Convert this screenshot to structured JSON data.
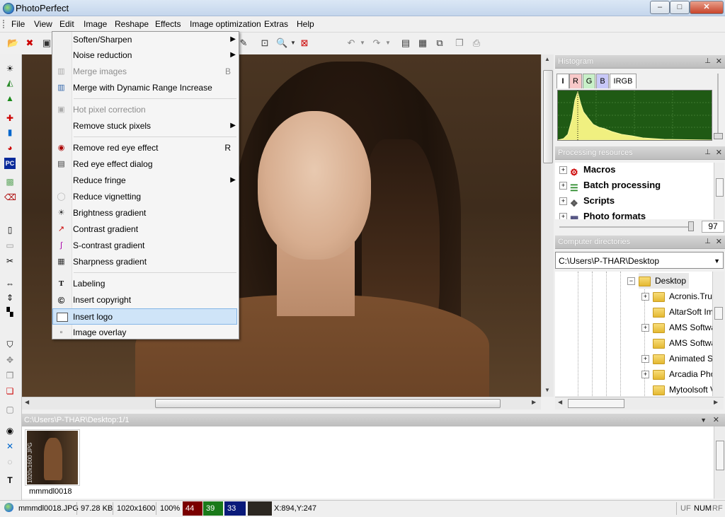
{
  "window": {
    "title": "PhotoPerfect",
    "controls": {
      "minimize": "–",
      "maximize": "□",
      "close": "✕"
    }
  },
  "menubar": {
    "items": [
      "File",
      "View",
      "Edit",
      "Image",
      "Reshape",
      "Effects",
      "Image optimization",
      "Extras",
      "Help"
    ]
  },
  "effects_menu": {
    "items": [
      {
        "label": "Soften/Sharpen",
        "submenu": "▶"
      },
      {
        "label": "Noise reduction",
        "submenu": "▶"
      },
      {
        "label": "Merge images",
        "key": "B"
      },
      {
        "label": "Merge with Dynamic Range Increase"
      },
      {
        "label": "Hot pixel correction"
      },
      {
        "label": "Remove stuck pixels",
        "submenu": "▶"
      },
      {
        "label": "Remove red eye effect",
        "key": "R"
      },
      {
        "label": "Red eye effect dialog"
      },
      {
        "label": "Reduce fringe",
        "submenu": "▶"
      },
      {
        "label": "Reduce vignetting"
      },
      {
        "label": "Brightness gradient"
      },
      {
        "label": "Contrast gradient"
      },
      {
        "label": "S-contrast gradient"
      },
      {
        "label": "Sharpness gradient"
      },
      {
        "label": "Labeling"
      },
      {
        "label": "Insert copyright"
      },
      {
        "label": "Insert logo"
      },
      {
        "label": "Image overlay"
      }
    ]
  },
  "panels": {
    "histogram": {
      "title": "Histogram",
      "tabs": [
        "I",
        "R",
        "G",
        "B",
        "IRGB"
      ],
      "tab_colors": [
        "#ffffff",
        "#f8c8c8",
        "#c8f0c8",
        "#c8c8f8",
        "#ffffff"
      ],
      "curve_color": "#f0f080",
      "background_color": "#1f5a14"
    },
    "processing_resources": {
      "title": "Processing resources",
      "items": [
        "Macros",
        "Batch processing",
        "Scripts",
        "Photo formats"
      ],
      "zoom_value": "97"
    },
    "computer_directories": {
      "title": "Computer directories",
      "path": "C:\\Users\\P-THAR\\Desktop",
      "root": "Desktop",
      "folders": [
        "Acronis.True",
        "AltarSoft Im",
        "AMS Softwa",
        "AMS Softwa",
        "Animated Sc",
        "Arcadia Phot",
        "Mytoolsoft V"
      ]
    },
    "panel_pin": "⊥",
    "panel_close": "✕"
  },
  "thumbnails": {
    "header": "C:\\Users\\P-THAR\\Desktop:1/1",
    "items": [
      {
        "name": "mmmdl0018",
        "side_text": "1020x1600 JPG"
      }
    ]
  },
  "statusbar": {
    "filename": "mmmdl0018.JPG",
    "filesize": "97.28 KB",
    "dimensions": "1020x1600",
    "zoom": "100%",
    "r": "44",
    "g": "39",
    "b": "33",
    "r_color": "#7a0000",
    "g_color": "#1a7a1a",
    "b_color": "#0a1a7a",
    "swatch_color": "#2c2721",
    "coords": "X:894,Y:247",
    "flags": [
      "UF",
      "NUM",
      "RF"
    ]
  }
}
